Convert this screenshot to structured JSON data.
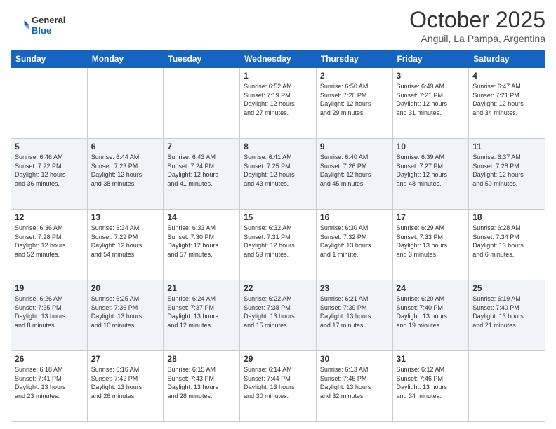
{
  "header": {
    "logo_general": "General",
    "logo_blue": "Blue",
    "month_title": "October 2025",
    "location": "Anguil, La Pampa, Argentina"
  },
  "days_of_week": [
    "Sunday",
    "Monday",
    "Tuesday",
    "Wednesday",
    "Thursday",
    "Friday",
    "Saturday"
  ],
  "weeks": [
    [
      {
        "day": "",
        "info": ""
      },
      {
        "day": "",
        "info": ""
      },
      {
        "day": "",
        "info": ""
      },
      {
        "day": "1",
        "info": "Sunrise: 6:52 AM\nSunset: 7:19 PM\nDaylight: 12 hours\nand 27 minutes."
      },
      {
        "day": "2",
        "info": "Sunrise: 6:50 AM\nSunset: 7:20 PM\nDaylight: 12 hours\nand 29 minutes."
      },
      {
        "day": "3",
        "info": "Sunrise: 6:49 AM\nSunset: 7:21 PM\nDaylight: 12 hours\nand 31 minutes."
      },
      {
        "day": "4",
        "info": "Sunrise: 6:47 AM\nSunset: 7:21 PM\nDaylight: 12 hours\nand 34 minutes."
      }
    ],
    [
      {
        "day": "5",
        "info": "Sunrise: 6:46 AM\nSunset: 7:22 PM\nDaylight: 12 hours\nand 36 minutes."
      },
      {
        "day": "6",
        "info": "Sunrise: 6:44 AM\nSunset: 7:23 PM\nDaylight: 12 hours\nand 38 minutes."
      },
      {
        "day": "7",
        "info": "Sunrise: 6:43 AM\nSunset: 7:24 PM\nDaylight: 12 hours\nand 41 minutes."
      },
      {
        "day": "8",
        "info": "Sunrise: 6:41 AM\nSunset: 7:25 PM\nDaylight: 12 hours\nand 43 minutes."
      },
      {
        "day": "9",
        "info": "Sunrise: 6:40 AM\nSunset: 7:26 PM\nDaylight: 12 hours\nand 45 minutes."
      },
      {
        "day": "10",
        "info": "Sunrise: 6:39 AM\nSunset: 7:27 PM\nDaylight: 12 hours\nand 48 minutes."
      },
      {
        "day": "11",
        "info": "Sunrise: 6:37 AM\nSunset: 7:28 PM\nDaylight: 12 hours\nand 50 minutes."
      }
    ],
    [
      {
        "day": "12",
        "info": "Sunrise: 6:36 AM\nSunset: 7:28 PM\nDaylight: 12 hours\nand 52 minutes."
      },
      {
        "day": "13",
        "info": "Sunrise: 6:34 AM\nSunset: 7:29 PM\nDaylight: 12 hours\nand 54 minutes."
      },
      {
        "day": "14",
        "info": "Sunrise: 6:33 AM\nSunset: 7:30 PM\nDaylight: 12 hours\nand 57 minutes."
      },
      {
        "day": "15",
        "info": "Sunrise: 6:32 AM\nSunset: 7:31 PM\nDaylight: 12 hours\nand 59 minutes."
      },
      {
        "day": "16",
        "info": "Sunrise: 6:30 AM\nSunset: 7:32 PM\nDaylight: 13 hours\nand 1 minute."
      },
      {
        "day": "17",
        "info": "Sunrise: 6:29 AM\nSunset: 7:33 PM\nDaylight: 13 hours\nand 3 minutes."
      },
      {
        "day": "18",
        "info": "Sunrise: 6:28 AM\nSunset: 7:34 PM\nDaylight: 13 hours\nand 6 minutes."
      }
    ],
    [
      {
        "day": "19",
        "info": "Sunrise: 6:26 AM\nSunset: 7:35 PM\nDaylight: 13 hours\nand 8 minutes."
      },
      {
        "day": "20",
        "info": "Sunrise: 6:25 AM\nSunset: 7:36 PM\nDaylight: 13 hours\nand 10 minutes."
      },
      {
        "day": "21",
        "info": "Sunrise: 6:24 AM\nSunset: 7:37 PM\nDaylight: 13 hours\nand 12 minutes."
      },
      {
        "day": "22",
        "info": "Sunrise: 6:22 AM\nSunset: 7:38 PM\nDaylight: 13 hours\nand 15 minutes."
      },
      {
        "day": "23",
        "info": "Sunrise: 6:21 AM\nSunset: 7:39 PM\nDaylight: 13 hours\nand 17 minutes."
      },
      {
        "day": "24",
        "info": "Sunrise: 6:20 AM\nSunset: 7:40 PM\nDaylight: 13 hours\nand 19 minutes."
      },
      {
        "day": "25",
        "info": "Sunrise: 6:19 AM\nSunset: 7:40 PM\nDaylight: 13 hours\nand 21 minutes."
      }
    ],
    [
      {
        "day": "26",
        "info": "Sunrise: 6:18 AM\nSunset: 7:41 PM\nDaylight: 13 hours\nand 23 minutes."
      },
      {
        "day": "27",
        "info": "Sunrise: 6:16 AM\nSunset: 7:42 PM\nDaylight: 13 hours\nand 26 minutes."
      },
      {
        "day": "28",
        "info": "Sunrise: 6:15 AM\nSunset: 7:43 PM\nDaylight: 13 hours\nand 28 minutes."
      },
      {
        "day": "29",
        "info": "Sunrise: 6:14 AM\nSunset: 7:44 PM\nDaylight: 13 hours\nand 30 minutes."
      },
      {
        "day": "30",
        "info": "Sunrise: 6:13 AM\nSunset: 7:45 PM\nDaylight: 13 hours\nand 32 minutes."
      },
      {
        "day": "31",
        "info": "Sunrise: 6:12 AM\nSunset: 7:46 PM\nDaylight: 13 hours\nand 34 minutes."
      },
      {
        "day": "",
        "info": ""
      }
    ]
  ]
}
